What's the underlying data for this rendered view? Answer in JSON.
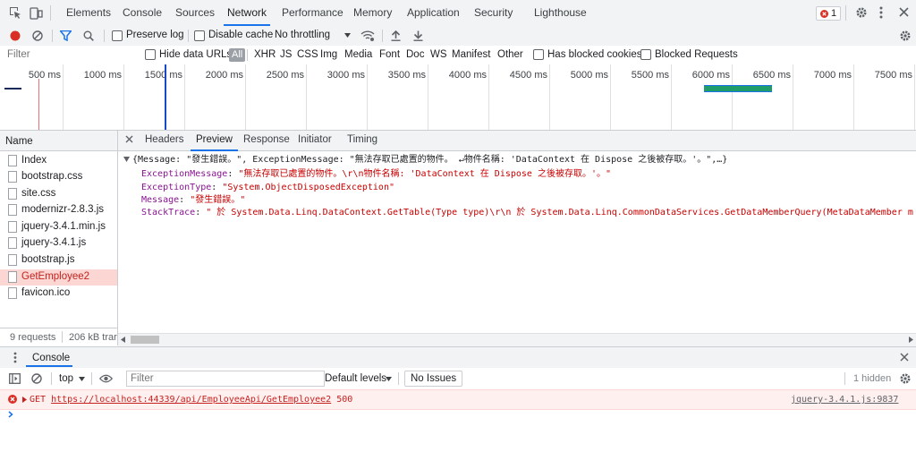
{
  "tabs": [
    "Elements",
    "Console",
    "Sources",
    "Network",
    "Performance",
    "Memory",
    "Application",
    "Security",
    "Lighthouse"
  ],
  "error_count": "1",
  "network_toolbar": {
    "preserve_log": "Preserve log",
    "disable_cache": "Disable cache",
    "throttling": "No throttling"
  },
  "filter_bar": {
    "filter_placeholder": "Filter",
    "hide_data_urls": "Hide data URLs",
    "all": "All",
    "types": [
      "XHR",
      "JS",
      "CSS",
      "Img",
      "Media",
      "Font",
      "Doc",
      "WS",
      "Manifest",
      "Other"
    ],
    "blocked_cookies": "Has blocked cookies",
    "blocked_requests": "Blocked Requests"
  },
  "timeline": {
    "ticks": [
      "500 ms",
      "1000 ms",
      "1500 ms",
      "2000 ms",
      "2500 ms",
      "3000 ms",
      "3500 ms",
      "4000 ms",
      "4500 ms",
      "5000 ms",
      "5500 ms",
      "6000 ms",
      "6500 ms",
      "7000 ms",
      "7500 ms"
    ]
  },
  "requests": {
    "header": "Name",
    "items": [
      "Index",
      "bootstrap.css",
      "site.css",
      "modernizr-2.8.3.js",
      "jquery-3.4.1.min.js",
      "jquery-3.4.1.js",
      "bootstrap.js",
      "GetEmployee2",
      "favicon.ico"
    ],
    "selected": "GetEmployee2",
    "count": "9 requests",
    "transferred": "206 kB trar"
  },
  "detail_tabs": [
    "Headers",
    "Preview",
    "Response",
    "Initiator",
    "Timing"
  ],
  "active_detail_tab": "Preview",
  "preview": {
    "summary": "{Message: \"發生錯誤。\", ExceptionMessage: \"無法存取已處置的物件。 ↵物件名稱: 'DataContext 在 Dispose 之後被存取。'。\",…}",
    "props": [
      {
        "key": "ExceptionMessage",
        "value": "\"無法存取已處置的物件。\\r\\n物件名稱: 'DataContext 在 Dispose 之後被存取。'。\""
      },
      {
        "key": "ExceptionType",
        "value": "\"System.ObjectDisposedException\""
      },
      {
        "key": "Message",
        "value": "\"發生錯誤。\""
      },
      {
        "key": "StackTrace",
        "value": "\"   於 System.Data.Linq.DataContext.GetTable(Type type)\\r\\n   於 System.Data.Linq.CommonDataServices.GetDataMemberQuery(MetaDataMember m"
      }
    ]
  },
  "drawer": {
    "title": "Console"
  },
  "console": {
    "context": "top",
    "filter_placeholder": "Filter",
    "levels": "Default levels",
    "issues": "No Issues",
    "hidden": "1 hidden",
    "error": {
      "method": "GET",
      "url": "https://localhost:44339/api/EmployeeApi/GetEmployee2",
      "status": "500",
      "source": "jquery-3.4.1.js:9837"
    }
  },
  "colors": {
    "accent": "#1a73e8",
    "error": "#d93025",
    "selected_row": "#fbd6d2"
  }
}
